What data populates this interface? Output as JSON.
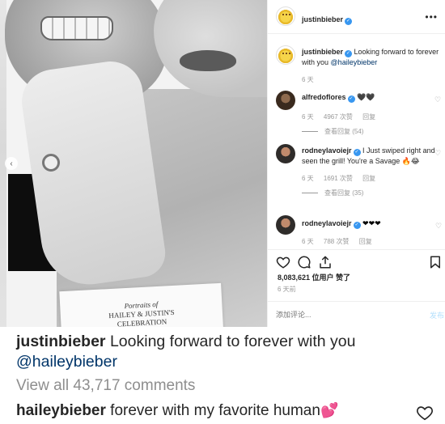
{
  "post": {
    "program_text_line1": "Portraits of",
    "program_text_line2": "HAILEY & JUSTIN'S",
    "program_text_line3": "CELEBRATION"
  },
  "header": {
    "username": "justinbieber",
    "verified_icon": "verified-badge-icon",
    "more_icon": "more-options-icon"
  },
  "caption": {
    "username": "justinbieber",
    "text": "Looking forward to forever with you",
    "mention": "@haileybieber",
    "time": "6 天"
  },
  "comments": [
    {
      "username": "alfredoflores",
      "text": "🖤🖤",
      "time": "6 天",
      "likes": "4967 次赞",
      "reply": "回复",
      "view_replies": "查看回复 (54)"
    },
    {
      "username": "rodneylavoiejr",
      "text": "I Just swiped right and seen the grill! You're a Savage 🔥😂",
      "time": "6 天",
      "likes": "1691 次赞",
      "reply": "回复",
      "view_replies": "查看回复 (35)"
    },
    {
      "username": "rodneylavoiejr",
      "text": "❤❤❤",
      "time": "6 天",
      "likes": "788 次赞",
      "reply": "回复"
    }
  ],
  "actions": {
    "likes_label": "8,083,621 位用户 赞了",
    "post_time": "6 天前",
    "add_comment_placeholder": "添加评论...",
    "publish_label": "发布"
  },
  "bottom": {
    "username": "justinbieber",
    "caption_text": "Looking forward to forever with you",
    "mention": "@haileybieber",
    "view_all": "View all 43,717 comments",
    "comment_username": "haileybieber",
    "comment_text": "forever with my favorite human"
  },
  "colors": {
    "accent_blue": "#3897f0",
    "mention": "#003569",
    "muted": "#8e8e8e",
    "emoji_heart": "#e2579c"
  }
}
